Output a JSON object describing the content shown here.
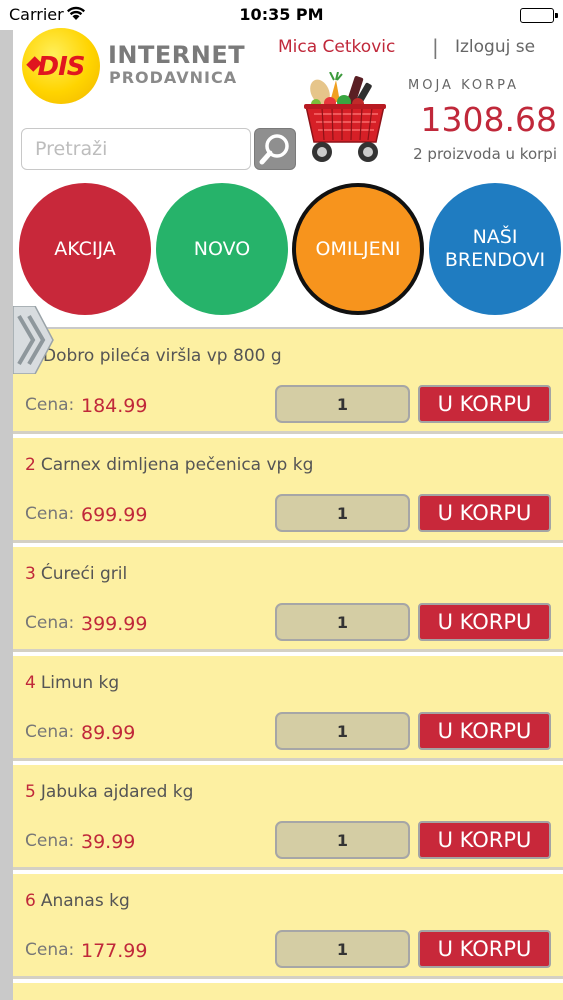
{
  "status_bar": {
    "carrier": "Carrier",
    "time": "10:35 PM"
  },
  "header": {
    "logo_text": "DIS",
    "brand_line1": "INTERNET",
    "brand_line2": "PRODAVNICA",
    "user_name": "Mica Cetkovic",
    "separator": "|",
    "logout_label": "Izloguj se"
  },
  "cart": {
    "title": "MOJA KORPA",
    "total": "1308.68",
    "count_text": "2 proizvoda u korpi"
  },
  "search": {
    "placeholder": "Pretraži"
  },
  "categories": [
    {
      "label_line1": "AKCIJA",
      "label_line2": "",
      "color": "#c8283a"
    },
    {
      "label_line1": "NOVO",
      "label_line2": "",
      "color": "#26b36a"
    },
    {
      "label_line1": "OMILJENI",
      "label_line2": "",
      "color": "#f7941d"
    },
    {
      "label_line1": "NAŠI",
      "label_line2": "BRENDOVI",
      "color": "#1f7cc1"
    }
  ],
  "product_list": {
    "price_label": "Cena:",
    "add_label": "U KORPU",
    "items": [
      {
        "num": "",
        "name": "Dobro pileća viršla vp 800 g",
        "price": "184.99",
        "qty": "1"
      },
      {
        "num": "2",
        "name": "Carnex dimljena pečenica vp kg",
        "price": "699.99",
        "qty": "1"
      },
      {
        "num": "3",
        "name": "Ćureći gril",
        "price": "399.99",
        "qty": "1"
      },
      {
        "num": "4",
        "name": "Limun kg",
        "price": "89.99",
        "qty": "1"
      },
      {
        "num": "5",
        "name": "Jabuka ajdared kg",
        "price": "39.99",
        "qty": "1"
      },
      {
        "num": "6",
        "name": "Ananas kg",
        "price": "177.99",
        "qty": "1"
      }
    ]
  },
  "colors": {
    "accent_red": "#c8283a",
    "row_bg": "#fdf0a2",
    "qty_bg": "#d4cda4"
  }
}
